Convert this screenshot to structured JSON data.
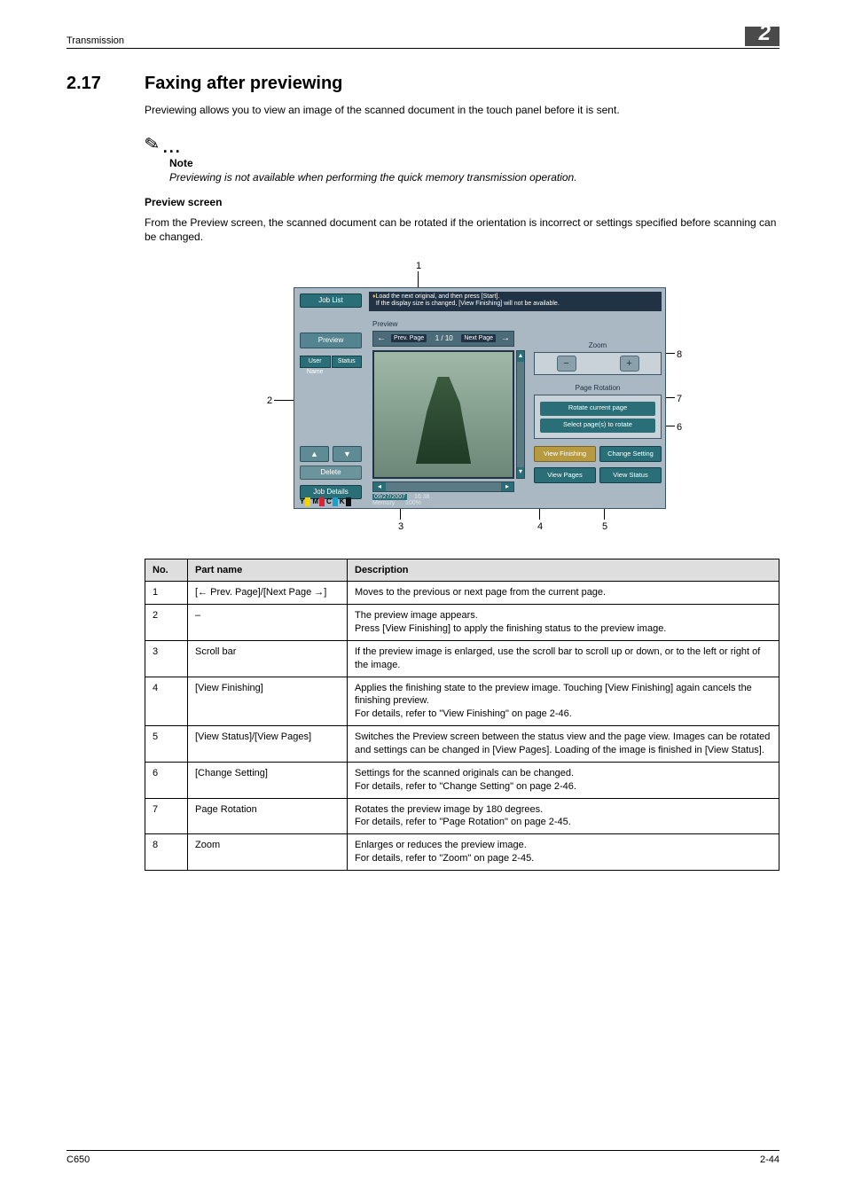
{
  "header": {
    "left": "Transmission",
    "chapter": "2"
  },
  "section": {
    "number": "2.17",
    "title": "Faxing after previewing",
    "intro": "Previewing allows you to view an image of the scanned document in the touch panel before it is sent."
  },
  "note": {
    "label": "Note",
    "text": "Previewing is not available when performing the quick memory transmission operation."
  },
  "preview": {
    "heading": "Preview screen",
    "para": "From the Preview screen, the scanned document can be rotated if the orientation is incorrect or settings specified before scanning can be changed."
  },
  "callouts": [
    "1",
    "2",
    "3",
    "4",
    "5",
    "6",
    "7",
    "8"
  ],
  "screenshot": {
    "msg_line1_prefix": "♦",
    "msg_line1": "Load the next original, and then press [Start].",
    "msg_line2": "If the display size is changed, [View Finishing] will not be available.",
    "job_list": "Job List",
    "preview_btn": "Preview",
    "status_btn1": "User\nName",
    "status_btn2": "Status",
    "delete": "Delete",
    "job_details": "Job Details",
    "preview_label": "Preview",
    "prev_page": "Prev.\nPage",
    "page_counter": "1 /     10",
    "next_page": "Next\nPage",
    "zoom_label": "Zoom",
    "rotation_label": "Page Rotation",
    "rotate_current": "Rotate current page",
    "select_pages": "Select page(s) to rotate",
    "view_finishing": "View Finishing",
    "change_setting": "Change Setting",
    "view_pages": "View Pages",
    "view_status": "View Status",
    "date": "09/27/2007",
    "time": "16:38",
    "memory": "Memory",
    "mem_pct": "100%"
  },
  "table": {
    "headers": [
      "No.",
      "Part name",
      "Description"
    ],
    "rows": [
      {
        "no": "1",
        "name": "[← Prev. Page]/[Next Page →]",
        "desc": "Moves to the previous or next page from the current page."
      },
      {
        "no": "2",
        "name": "–",
        "desc": "The preview image appears.\nPress [View Finishing] to apply the finishing status to the preview image."
      },
      {
        "no": "3",
        "name": "Scroll bar",
        "desc": "If the preview image is enlarged, use the scroll bar to scroll up or down, or to the left or right of the image."
      },
      {
        "no": "4",
        "name": "[View Finishing]",
        "desc": "Applies the finishing state to the preview image. Touching [View Finishing] again cancels the finishing preview.\nFor details, refer to \"View Finishing\" on page 2-46."
      },
      {
        "no": "5",
        "name": "[View Status]/[View Pages]",
        "desc": "Switches the Preview screen between the status view and the page view. Images can be rotated and settings can be changed in [View Pages]. Loading of the image is finished in [View Status]."
      },
      {
        "no": "6",
        "name": "[Change Setting]",
        "desc": "Settings for the scanned originals can be changed.\nFor details, refer to \"Change Setting\" on page 2-46."
      },
      {
        "no": "7",
        "name": "Page Rotation",
        "desc": "Rotates the preview image by 180 degrees.\nFor details, refer to \"Page Rotation\" on page 2-45."
      },
      {
        "no": "8",
        "name": "Zoom",
        "desc": "Enlarges or reduces the preview image.\nFor details, refer to \"Zoom\" on page 2-45."
      }
    ]
  },
  "footer": {
    "left": "C650",
    "right": "2-44"
  }
}
